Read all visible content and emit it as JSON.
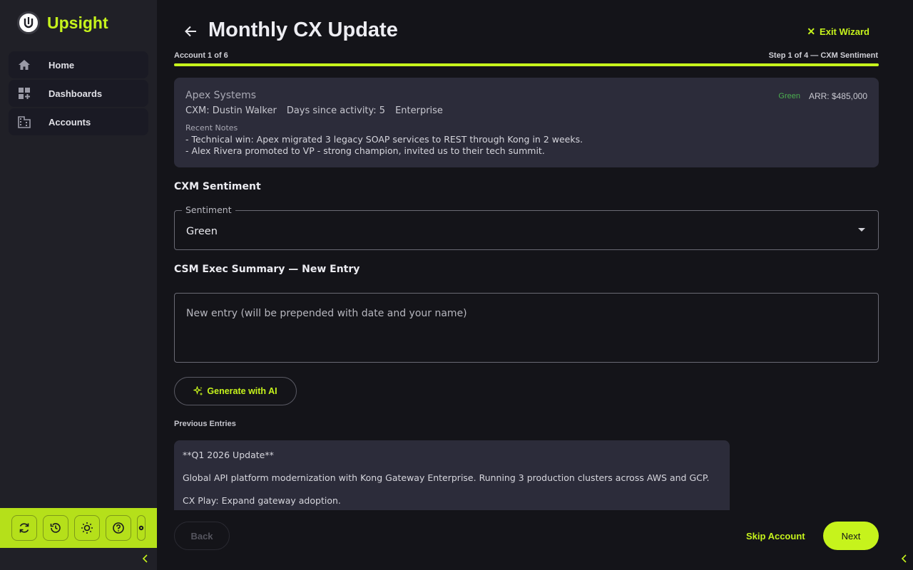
{
  "brand": {
    "name": "Upsight"
  },
  "sidebar": {
    "items": [
      {
        "label": "Home",
        "icon": "home-icon"
      },
      {
        "label": "Dashboards",
        "icon": "dashboard-icon"
      },
      {
        "label": "Accounts",
        "icon": "building-icon"
      }
    ],
    "toolbar_icons": [
      "sync-icon",
      "history-icon",
      "sun-icon",
      "help-icon",
      "gear-icon"
    ]
  },
  "header": {
    "title": "Monthly CX Update",
    "exit_label": "Exit Wizard",
    "account_progress": "Account 1 of 6",
    "step_progress": "Step 1 of 4 — CXM Sentiment",
    "progress_fraction": 1.0
  },
  "account": {
    "name": "Apex Systems",
    "status": "Green",
    "arr": "ARR: $485,000",
    "cxm": "CXM: Dustin Walker",
    "days": "Days since activity: 5",
    "segment": "Enterprise",
    "notes_label": "Recent Notes",
    "notes": [
      "- Technical win: Apex migrated 3 legacy SOAP services to REST through Kong in 2 weeks.",
      "- Alex Rivera promoted to VP - strong champion, invited us to their tech summit."
    ]
  },
  "sentiment": {
    "section_title": "CXM Sentiment",
    "legend": "Sentiment",
    "value": "Green"
  },
  "summary": {
    "section_title": "CSM Exec Summary — New Entry",
    "placeholder": "New entry (will be prepended with date and your name)",
    "ai_button": "Generate with AI"
  },
  "previous": {
    "label": "Previous Entries",
    "lines": [
      "**Q1 2026 Update**",
      "Global API platform modernization with Kong Gateway Enterprise. Running 3 production clusters across AWS and GCP.",
      "CX Play: Expand gateway adoption."
    ]
  },
  "footer": {
    "back": "Back",
    "skip": "Skip Account",
    "next": "Next"
  },
  "colors": {
    "accent": "#c6f31c",
    "status_green": "#4caf50",
    "background": "#141419",
    "sidebar": "#202027",
    "card": "#2c2c3a"
  }
}
